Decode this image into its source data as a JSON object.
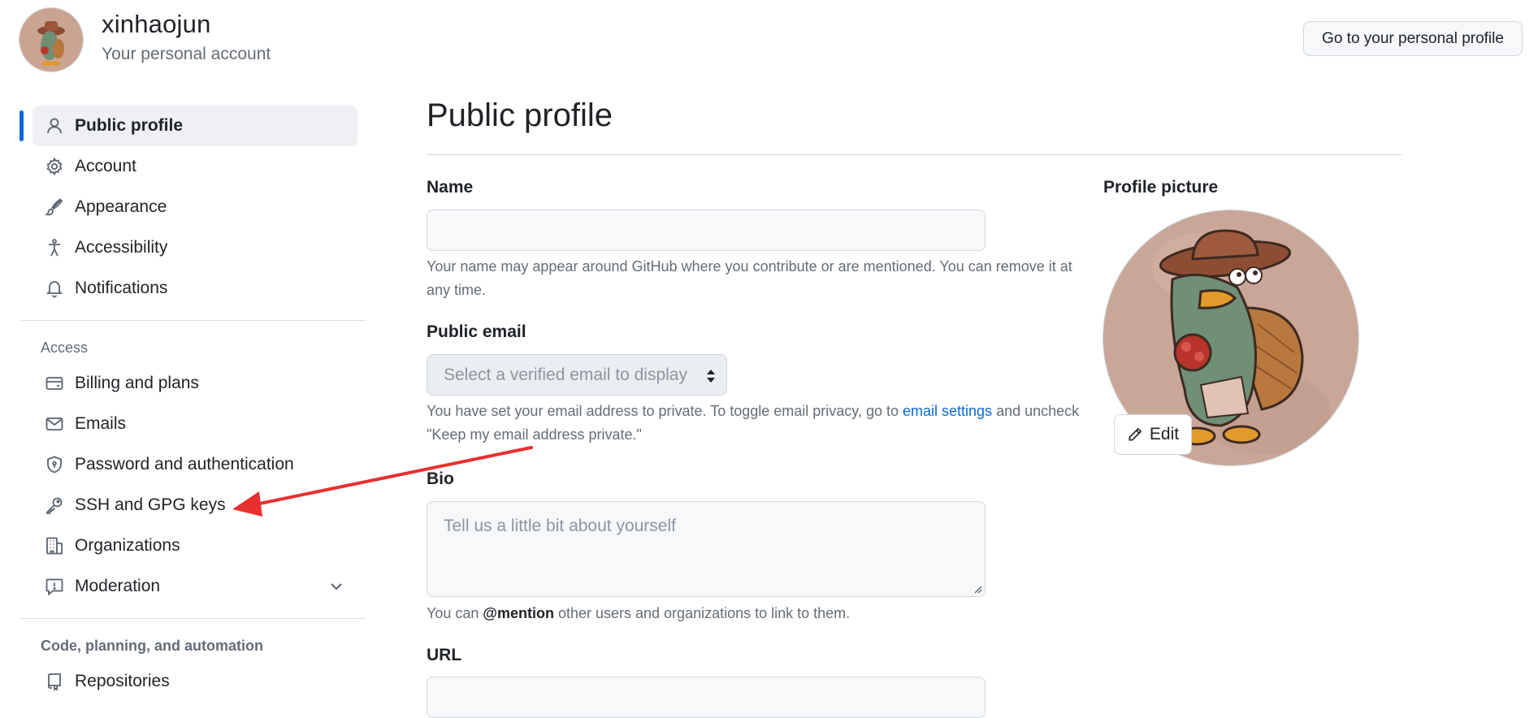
{
  "header": {
    "username": "xinhaojun",
    "subtitle": "Your personal account",
    "profile_button": "Go to your personal profile"
  },
  "sidebar": {
    "items": [
      {
        "label": "Public profile",
        "icon": "person-icon",
        "active": true
      },
      {
        "label": "Account",
        "icon": "gear-icon"
      },
      {
        "label": "Appearance",
        "icon": "paintbrush-icon"
      },
      {
        "label": "Accessibility",
        "icon": "accessibility-icon"
      },
      {
        "label": "Notifications",
        "icon": "bell-icon"
      }
    ],
    "access_heading": "Access",
    "access_items": [
      {
        "label": "Billing and plans",
        "icon": "credit-card-icon"
      },
      {
        "label": "Emails",
        "icon": "mail-icon"
      },
      {
        "label": "Password and authentication",
        "icon": "shield-lock-icon"
      },
      {
        "label": "SSH and GPG keys",
        "icon": "key-icon"
      },
      {
        "label": "Organizations",
        "icon": "organization-icon"
      },
      {
        "label": "Moderation",
        "icon": "report-icon",
        "expandable": true
      }
    ],
    "code_heading": "Code, planning, and automation",
    "code_items": [
      {
        "label": "Repositories",
        "icon": "repo-icon"
      }
    ]
  },
  "main": {
    "title": "Public profile",
    "name": {
      "label": "Name",
      "value": "",
      "note": "Your name may appear around GitHub where you contribute or are mentioned. You can remove it at any time."
    },
    "public_email": {
      "label": "Public email",
      "selected": "Select a verified email to display",
      "note_before": "You have set your email address to private. To toggle email privacy, go to ",
      "note_link": "email settings",
      "note_after": " and uncheck \"Keep my email address private.\""
    },
    "bio": {
      "label": "Bio",
      "placeholder": "Tell us a little bit about yourself",
      "note_before": "You can ",
      "note_mention": "@mention",
      "note_after": " other users and organizations to link to them."
    },
    "url": {
      "label": "URL",
      "value": ""
    }
  },
  "profile_picture": {
    "label": "Profile picture",
    "edit_label": "Edit"
  },
  "colors": {
    "accent": "#0969da",
    "annotation_arrow": "#e8302f"
  }
}
